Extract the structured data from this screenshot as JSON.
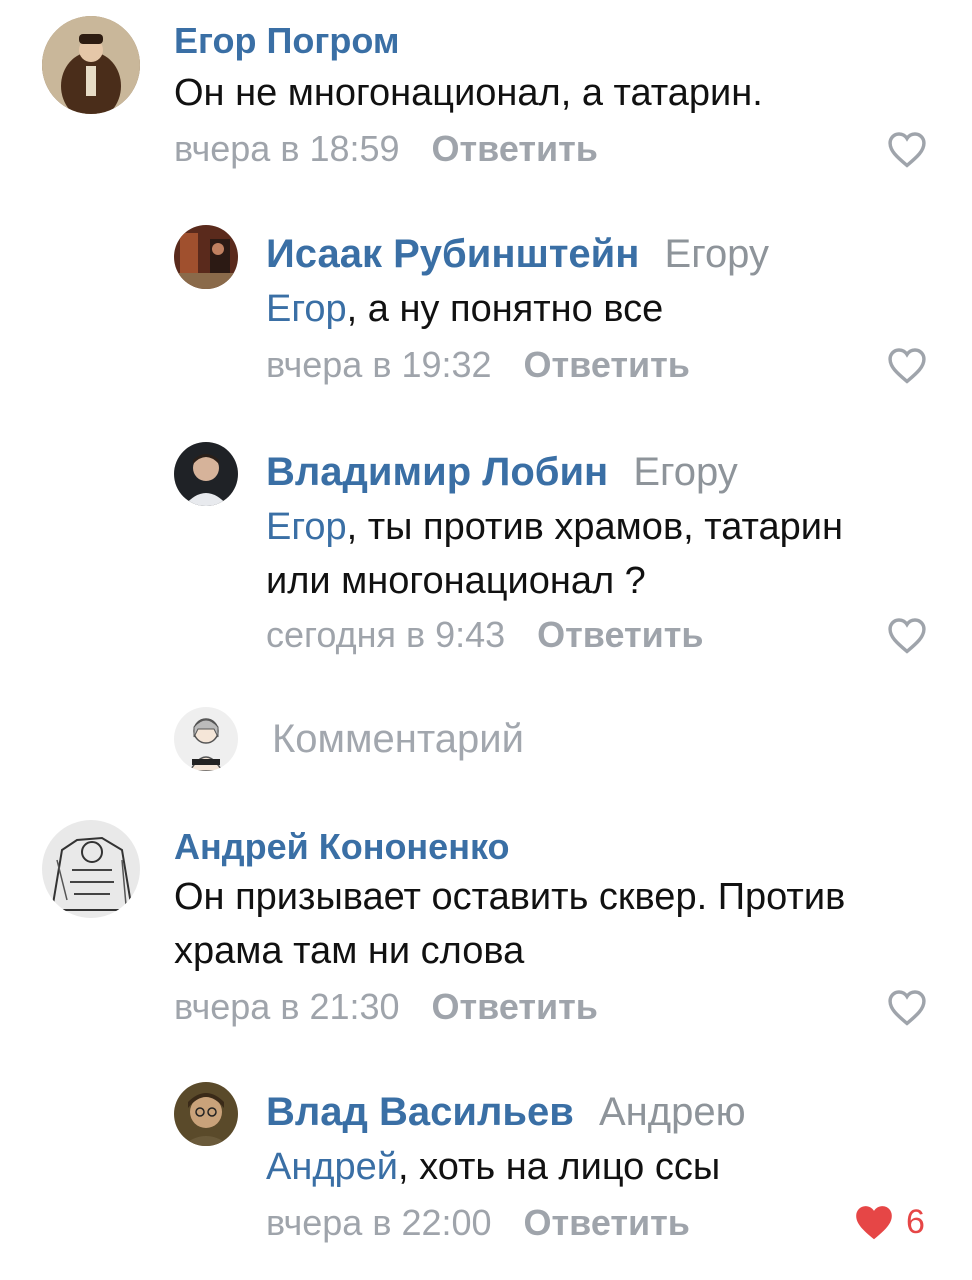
{
  "comments": [
    {
      "author": "Егор Погром",
      "text": "Он не многонационал, а татарин.",
      "time": "вчера в 18:59",
      "reply_label": "Ответить",
      "replies": [
        {
          "author": "Исаак Рубинштейн",
          "reply_to": "Егору",
          "mention": "Егор",
          "text": ", а ну понятно все",
          "time": "вчера в 19:32",
          "reply_label": "Ответить"
        },
        {
          "author": "Владимир Лобин",
          "reply_to": "Егору",
          "mention": "Егор",
          "text_line1": ", ты против храмов, татарин",
          "text_line2": "или многонационал ?",
          "time": "сегодня в 9:43",
          "reply_label": "Ответить"
        }
      ]
    },
    {
      "author": "Андрей Кононенко",
      "text_line1": "Он призывает оставить сквер. Против",
      "text_line2": "храма там ни слова",
      "time": "вчера в 21:30",
      "reply_label": "Ответить",
      "replies": [
        {
          "author": "Влад Васильев",
          "reply_to": "Андрею",
          "mention": "Андрей",
          "text": ", хоть на лицо ссы",
          "time": "вчера в 22:00",
          "reply_label": "Ответить",
          "likes": "6",
          "liked": true
        }
      ]
    }
  ],
  "composer": {
    "placeholder": "Комментарий"
  },
  "colors": {
    "link": "#3a6fa5",
    "meta": "#9fa4ab",
    "like_active": "#e64646",
    "like_inactive": "#9fa4ab"
  },
  "icons": {
    "like": "heart-outline-icon",
    "liked": "heart-filled-icon"
  }
}
